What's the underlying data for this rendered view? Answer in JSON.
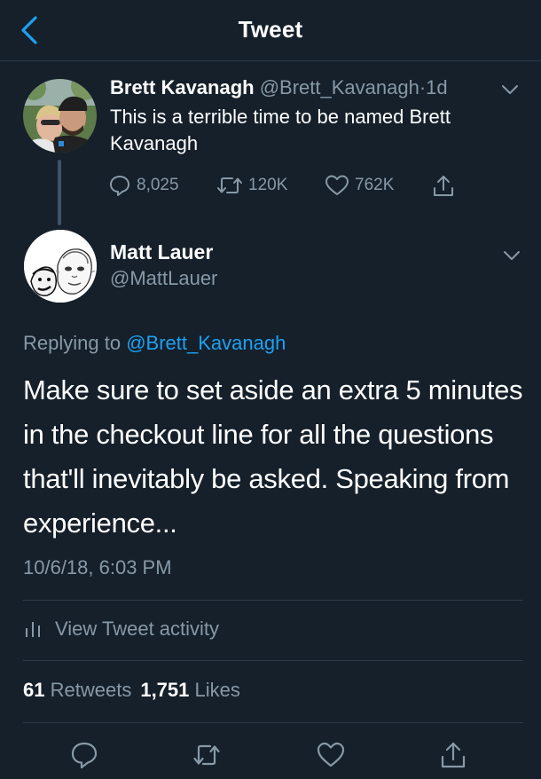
{
  "header": {
    "title": "Tweet",
    "back_icon": "chevron-left-icon"
  },
  "parent_tweet": {
    "name": "Brett Kavanagh",
    "handle": "@Brett_Kavanagh",
    "separator": "·",
    "time": "1d",
    "text": "This is a terrible time to be named Brett Kavanagh",
    "replies": "8,025",
    "retweets": "120K",
    "likes": "762K"
  },
  "reply_tweet": {
    "name": "Matt Lauer",
    "handle": "@MattLauer",
    "replying_prefix": "Replying to",
    "replying_to": "@Brett_Kavanagh",
    "text": "Make sure to set aside an extra 5 minutes in the checkout line for all the questions that'll inevitably be asked. Speaking from experience...",
    "timestamp": "10/6/18, 6:03 PM",
    "activity_label": "View Tweet activity",
    "retweet_count": "61",
    "retweet_label": "Retweets",
    "like_count": "1,751",
    "like_label": "Likes"
  },
  "colors": {
    "background": "#15202b",
    "accent": "#1da1f2",
    "secondary_text": "#8899a6",
    "divider": "#2c3a48"
  }
}
